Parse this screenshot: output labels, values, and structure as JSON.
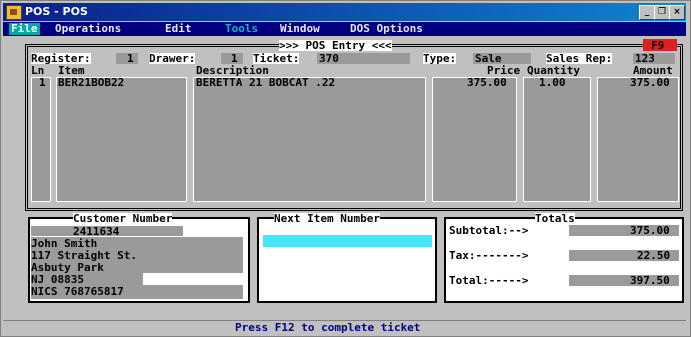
{
  "window": {
    "title": "POS - POS"
  },
  "menu": [
    {
      "label": "File",
      "state": "active"
    },
    {
      "label": "Operations",
      "state": "normal"
    },
    {
      "label": "Edit",
      "state": "normal"
    },
    {
      "label": "Tools",
      "state": "dim"
    },
    {
      "label": "Window",
      "state": "normal"
    },
    {
      "label": "DOS Options",
      "state": "normal"
    }
  ],
  "entry": {
    "heading": ">>> POS Entry <<<",
    "function_key": "F9",
    "register_label": "Register:",
    "register_value": "1",
    "drawer_label": "Drawer:",
    "drawer_value": "1",
    "ticket_label": "Ticket:",
    "ticket_value": "370",
    "type_label": "Type:",
    "type_value": "Sale",
    "salesrep_label": "Sales Rep:",
    "salesrep_value": "123"
  },
  "table": {
    "headers": [
      "Ln",
      "Item",
      "Description",
      "Price",
      "Quantity",
      "Amount"
    ],
    "rows": [
      {
        "ln": "1",
        "item": "BER21BOB22",
        "description": "BERETTA 21 BOBCAT .22",
        "price": "375.00",
        "quantity": "1.00",
        "amount": "375.00"
      }
    ]
  },
  "customer": {
    "title": "Customer Number",
    "number": "2411634",
    "lines": [
      "John Smith",
      "117 Straight St.",
      "Asbuty Park",
      "NJ 08835",
      "NICS 768765817"
    ]
  },
  "next_item": {
    "title": "Next Item Number",
    "value": ""
  },
  "totals": {
    "title": "Totals",
    "subtotal_label": "Subtotal:-->",
    "subtotal": "375.00",
    "tax_label": "Tax:------->",
    "tax": "22.50",
    "total_label": "Total:----->",
    "total": "397.50"
  },
  "status": "Press F12 to complete ticket",
  "colors": {
    "field_gray": "#9a9a9a",
    "accent_cyan": "#40e8f8",
    "menu_navy": "#000080",
    "fkey_red": "#e02020"
  }
}
